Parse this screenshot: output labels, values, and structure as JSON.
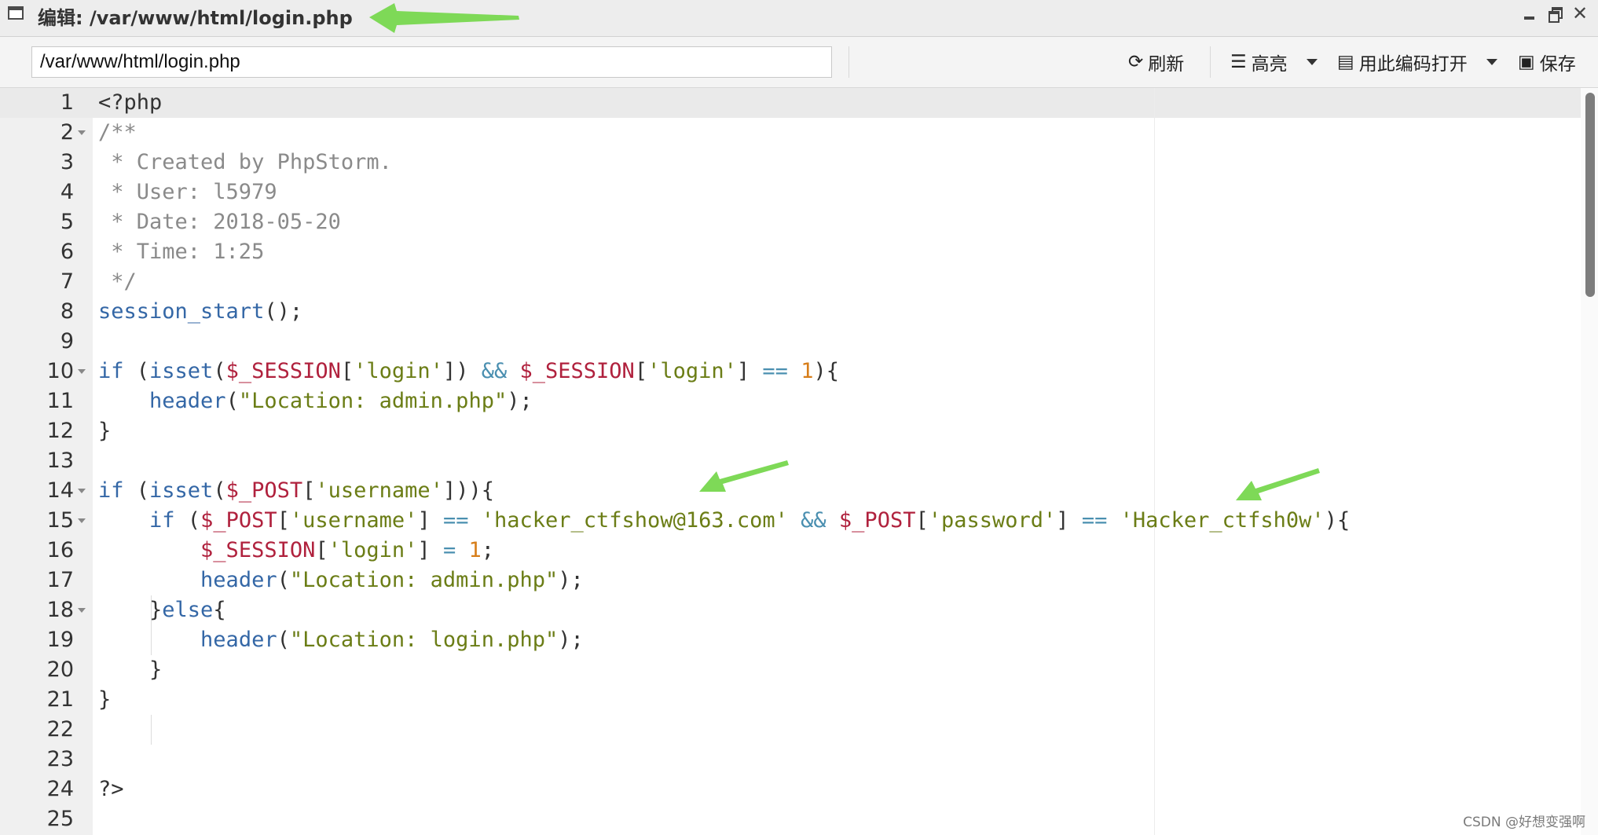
{
  "window": {
    "title": "编辑: /var/www/html/login.php",
    "controls": {
      "minimize": "minimize",
      "maximize": "restore",
      "close": "✕"
    }
  },
  "toolbar": {
    "path_value": "/var/www/html/login.php",
    "refresh_label": "刷新",
    "highlight_label": "高亮",
    "open_with_encoding_label": "用此编码打开",
    "save_label": "保存",
    "icons": {
      "refresh": "refresh-icon",
      "highlight": "list-icon",
      "encoding": "book-icon",
      "save": "floppy-icon"
    }
  },
  "editor": {
    "active_line": 1,
    "fold_lines": [
      2,
      10,
      14,
      15,
      18
    ],
    "lines": [
      {
        "n": "1",
        "tokens": [
          [
            "plain",
            "<?php"
          ]
        ]
      },
      {
        "n": "2",
        "tokens": [
          [
            "comment",
            "/**"
          ]
        ]
      },
      {
        "n": "3",
        "tokens": [
          [
            "comment",
            " * Created by PhpStorm."
          ]
        ]
      },
      {
        "n": "4",
        "tokens": [
          [
            "comment",
            " * User: l5979"
          ]
        ]
      },
      {
        "n": "5",
        "tokens": [
          [
            "comment",
            " * Date: 2018-05-20"
          ]
        ]
      },
      {
        "n": "6",
        "tokens": [
          [
            "comment",
            " * Time: 1:25"
          ]
        ]
      },
      {
        "n": "7",
        "tokens": [
          [
            "comment",
            " */"
          ]
        ]
      },
      {
        "n": "8",
        "tokens": [
          [
            "func",
            "session_start"
          ],
          [
            "plain",
            "();"
          ]
        ]
      },
      {
        "n": "9",
        "tokens": []
      },
      {
        "n": "10",
        "tokens": [
          [
            "kw",
            "if"
          ],
          [
            "plain",
            " ("
          ],
          [
            "func",
            "isset"
          ],
          [
            "plain",
            "("
          ],
          [
            "var",
            "$_SESSION"
          ],
          [
            "plain",
            "["
          ],
          [
            "str",
            "'login'"
          ],
          [
            "plain",
            "]) "
          ],
          [
            "op",
            "&&"
          ],
          [
            "plain",
            " "
          ],
          [
            "var",
            "$_SESSION"
          ],
          [
            "plain",
            "["
          ],
          [
            "str",
            "'login'"
          ],
          [
            "plain",
            "] "
          ],
          [
            "op",
            "=="
          ],
          [
            "plain",
            " "
          ],
          [
            "num",
            "1"
          ],
          [
            "plain",
            "){"
          ]
        ]
      },
      {
        "n": "11",
        "tokens": [
          [
            "plain",
            "    "
          ],
          [
            "func",
            "header"
          ],
          [
            "plain",
            "("
          ],
          [
            "str",
            "\"Location: admin.php\""
          ],
          [
            "plain",
            ");"
          ]
        ]
      },
      {
        "n": "12",
        "tokens": [
          [
            "plain",
            "}"
          ]
        ]
      },
      {
        "n": "13",
        "tokens": []
      },
      {
        "n": "14",
        "tokens": [
          [
            "kw",
            "if"
          ],
          [
            "plain",
            " ("
          ],
          [
            "func",
            "isset"
          ],
          [
            "plain",
            "("
          ],
          [
            "var",
            "$_POST"
          ],
          [
            "plain",
            "["
          ],
          [
            "str",
            "'username'"
          ],
          [
            "plain",
            "])){"
          ]
        ]
      },
      {
        "n": "15",
        "tokens": [
          [
            "plain",
            "    "
          ],
          [
            "kw",
            "if"
          ],
          [
            "plain",
            " ("
          ],
          [
            "var",
            "$_POST"
          ],
          [
            "plain",
            "["
          ],
          [
            "str",
            "'username'"
          ],
          [
            "plain",
            "] "
          ],
          [
            "op",
            "=="
          ],
          [
            "plain",
            " "
          ],
          [
            "str",
            "'hacker_ctfshow@163.com'"
          ],
          [
            "plain",
            " "
          ],
          [
            "op",
            "&&"
          ],
          [
            "plain",
            " "
          ],
          [
            "var",
            "$_POST"
          ],
          [
            "plain",
            "["
          ],
          [
            "str",
            "'password'"
          ],
          [
            "plain",
            "] "
          ],
          [
            "op",
            "=="
          ],
          [
            "plain",
            " "
          ],
          [
            "str",
            "'Hacker_ctfsh0w'"
          ],
          [
            "plain",
            "){"
          ]
        ]
      },
      {
        "n": "16",
        "tokens": [
          [
            "plain",
            "        "
          ],
          [
            "var",
            "$_SESSION"
          ],
          [
            "plain",
            "["
          ],
          [
            "str",
            "'login'"
          ],
          [
            "plain",
            "] "
          ],
          [
            "op",
            "="
          ],
          [
            "plain",
            " "
          ],
          [
            "num",
            "1"
          ],
          [
            "plain",
            ";"
          ]
        ]
      },
      {
        "n": "17",
        "tokens": [
          [
            "plain",
            "        "
          ],
          [
            "func",
            "header"
          ],
          [
            "plain",
            "("
          ],
          [
            "str",
            "\"Location: admin.php\""
          ],
          [
            "plain",
            ");"
          ]
        ]
      },
      {
        "n": "18",
        "tokens": [
          [
            "plain",
            "    }"
          ],
          [
            "kw",
            "else"
          ],
          [
            "plain",
            "{"
          ]
        ]
      },
      {
        "n": "19",
        "tokens": [
          [
            "plain",
            "        "
          ],
          [
            "func",
            "header"
          ],
          [
            "plain",
            "("
          ],
          [
            "str",
            "\"Location: login.php\""
          ],
          [
            "plain",
            ");"
          ]
        ]
      },
      {
        "n": "20",
        "tokens": [
          [
            "plain",
            "    }"
          ]
        ]
      },
      {
        "n": "21",
        "tokens": [
          [
            "plain",
            "}"
          ]
        ]
      },
      {
        "n": "22",
        "tokens": []
      },
      {
        "n": "23",
        "tokens": []
      },
      {
        "n": "24",
        "tokens": [
          [
            "plain",
            "?>"
          ]
        ]
      },
      {
        "n": "25",
        "tokens": []
      }
    ]
  },
  "colors": {
    "arrow": "#7ed957",
    "comment": "#8a8a8a",
    "function": "#3467a6",
    "variable": "#b0213d",
    "string": "#6b7d16",
    "number": "#d77e1a",
    "operator": "#4a8fb0"
  },
  "watermark": "CSDN @好想变强啊"
}
